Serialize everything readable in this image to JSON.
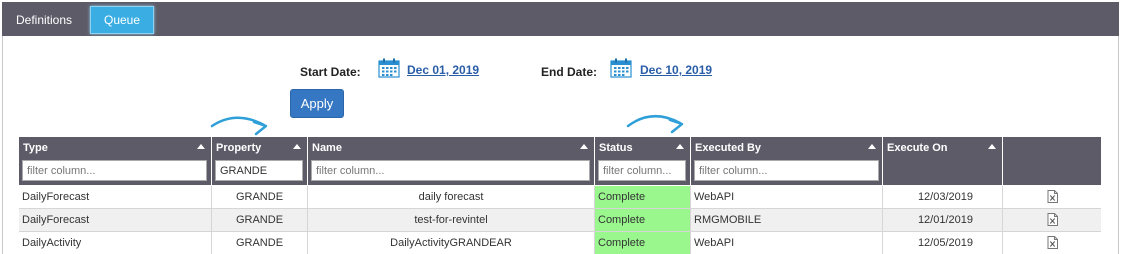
{
  "tabs": [
    {
      "label": "Definitions"
    },
    {
      "label": "Queue"
    }
  ],
  "dates": {
    "start_label": "Start Date:",
    "start_value": "Dec 01, 2019",
    "end_label": "End Date:",
    "end_value": "Dec 10, 2019"
  },
  "apply_label": "Apply",
  "columns": [
    {
      "label": "Type",
      "filter_placeholder": "filter column...",
      "filter_value": ""
    },
    {
      "label": "Property",
      "filter_placeholder": "filter column...",
      "filter_value": "GRANDE"
    },
    {
      "label": "Name",
      "filter_placeholder": "filter column...",
      "filter_value": ""
    },
    {
      "label": "Status",
      "filter_placeholder": "filter column...",
      "filter_value": ""
    },
    {
      "label": "Executed By",
      "filter_placeholder": "filter column...",
      "filter_value": ""
    },
    {
      "label": "Execute On"
    }
  ],
  "rows": [
    {
      "type": "DailyForecast",
      "property": "GRANDE",
      "name": "daily forecast",
      "status": "Complete",
      "executed_by": "WebAPI",
      "execute_on": "12/03/2019",
      "icon": "excel-file-icon"
    },
    {
      "type": "DailyForecast",
      "property": "GRANDE",
      "name": "test-for-revintel",
      "status": "Complete",
      "executed_by": "RMGMOBILE",
      "execute_on": "12/01/2019",
      "icon": "excel-file-icon"
    },
    {
      "type": "DailyActivity",
      "property": "GRANDE",
      "name": "DailyActivityGRANDEAR",
      "status": "Complete",
      "executed_by": "WebAPI",
      "execute_on": "12/05/2019",
      "icon": "excel-file-icon"
    }
  ],
  "colors": {
    "header_bg": "#5e5b68",
    "active_tab": "#3aaee3",
    "apply_button": "#3577c3",
    "status_complete": "#99f78e",
    "link": "#2a5da8",
    "annotation_arrow": "#2f9fd8"
  }
}
